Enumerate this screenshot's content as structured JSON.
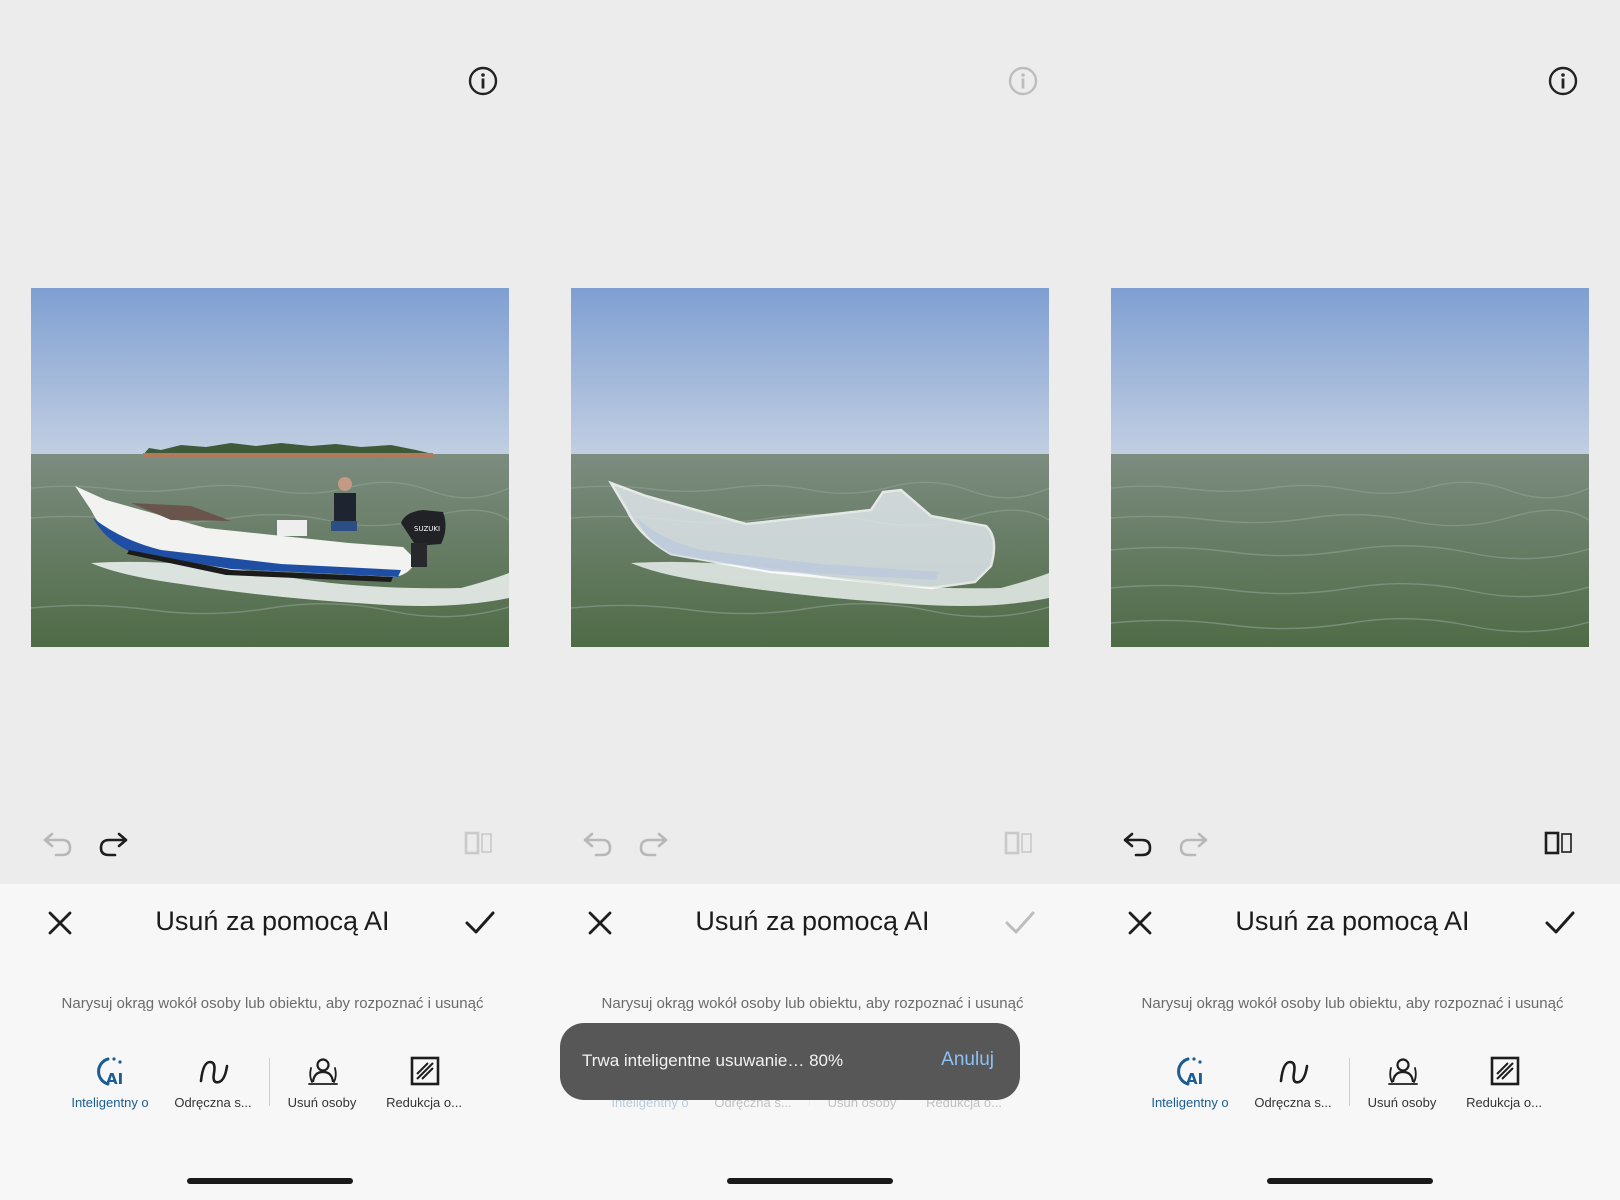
{
  "panels": [
    {
      "title": "Usuń za pomocą AI",
      "hint": "Narysuj okrąg wokół osoby lub obiektu, aby rozpoznać i usunąć",
      "tools": [
        {
          "label": "Inteligentny o",
          "icon": "ai-select-icon",
          "active": true
        },
        {
          "label": "Odręczna s...",
          "icon": "freehand-icon",
          "active": false
        },
        {
          "label": "Usuń osoby",
          "icon": "remove-people-icon",
          "active": false
        },
        {
          "label": "Redukcja o...",
          "icon": "reflection-reduction-icon",
          "active": false
        }
      ],
      "photo": "boat-original",
      "state": {
        "undo": false,
        "redo": true,
        "compare": false,
        "confirm": true,
        "info": true
      }
    },
    {
      "title": "Usuń za pomocą AI",
      "hint": "Narysuj okrąg wokół osoby lub obiektu, aby rozpoznać i usunąć",
      "tools": [
        {
          "label": "Inteligentny o",
          "icon": "ai-select-icon",
          "active": true
        },
        {
          "label": "Odręczna s...",
          "icon": "freehand-icon",
          "active": false
        },
        {
          "label": "Usuń osoby",
          "icon": "remove-people-icon",
          "active": false
        },
        {
          "label": "Redukcja o...",
          "icon": "reflection-reduction-icon",
          "active": false
        }
      ],
      "photo": "boat-selected",
      "toast": {
        "text": "Trwa inteligentne usuwanie… 80%",
        "progress": 0.8,
        "cancel_label": "Anuluj"
      },
      "state": {
        "undo": false,
        "redo": false,
        "compare": false,
        "confirm": false,
        "info": false
      }
    },
    {
      "title": "Usuń za pomocą AI",
      "hint": "Narysuj okrąg wokół osoby lub obiektu, aby rozpoznać i usunąć",
      "tools": [
        {
          "label": "Inteligentny o",
          "icon": "ai-select-icon",
          "active": true
        },
        {
          "label": "Odręczna s...",
          "icon": "freehand-icon",
          "active": false
        },
        {
          "label": "Usuń osoby",
          "icon": "remove-people-icon",
          "active": false
        },
        {
          "label": "Redukcja o...",
          "icon": "reflection-reduction-icon",
          "active": false
        }
      ],
      "photo": "boat-removed",
      "state": {
        "undo": true,
        "redo": false,
        "compare": true,
        "confirm": true,
        "info": true
      }
    }
  ],
  "colors": {
    "accent": "#1a5c94",
    "sheet": "#f7f7f7",
    "background": "#ececec",
    "toast": "#575757",
    "toast_action": "#8cc1f5"
  }
}
